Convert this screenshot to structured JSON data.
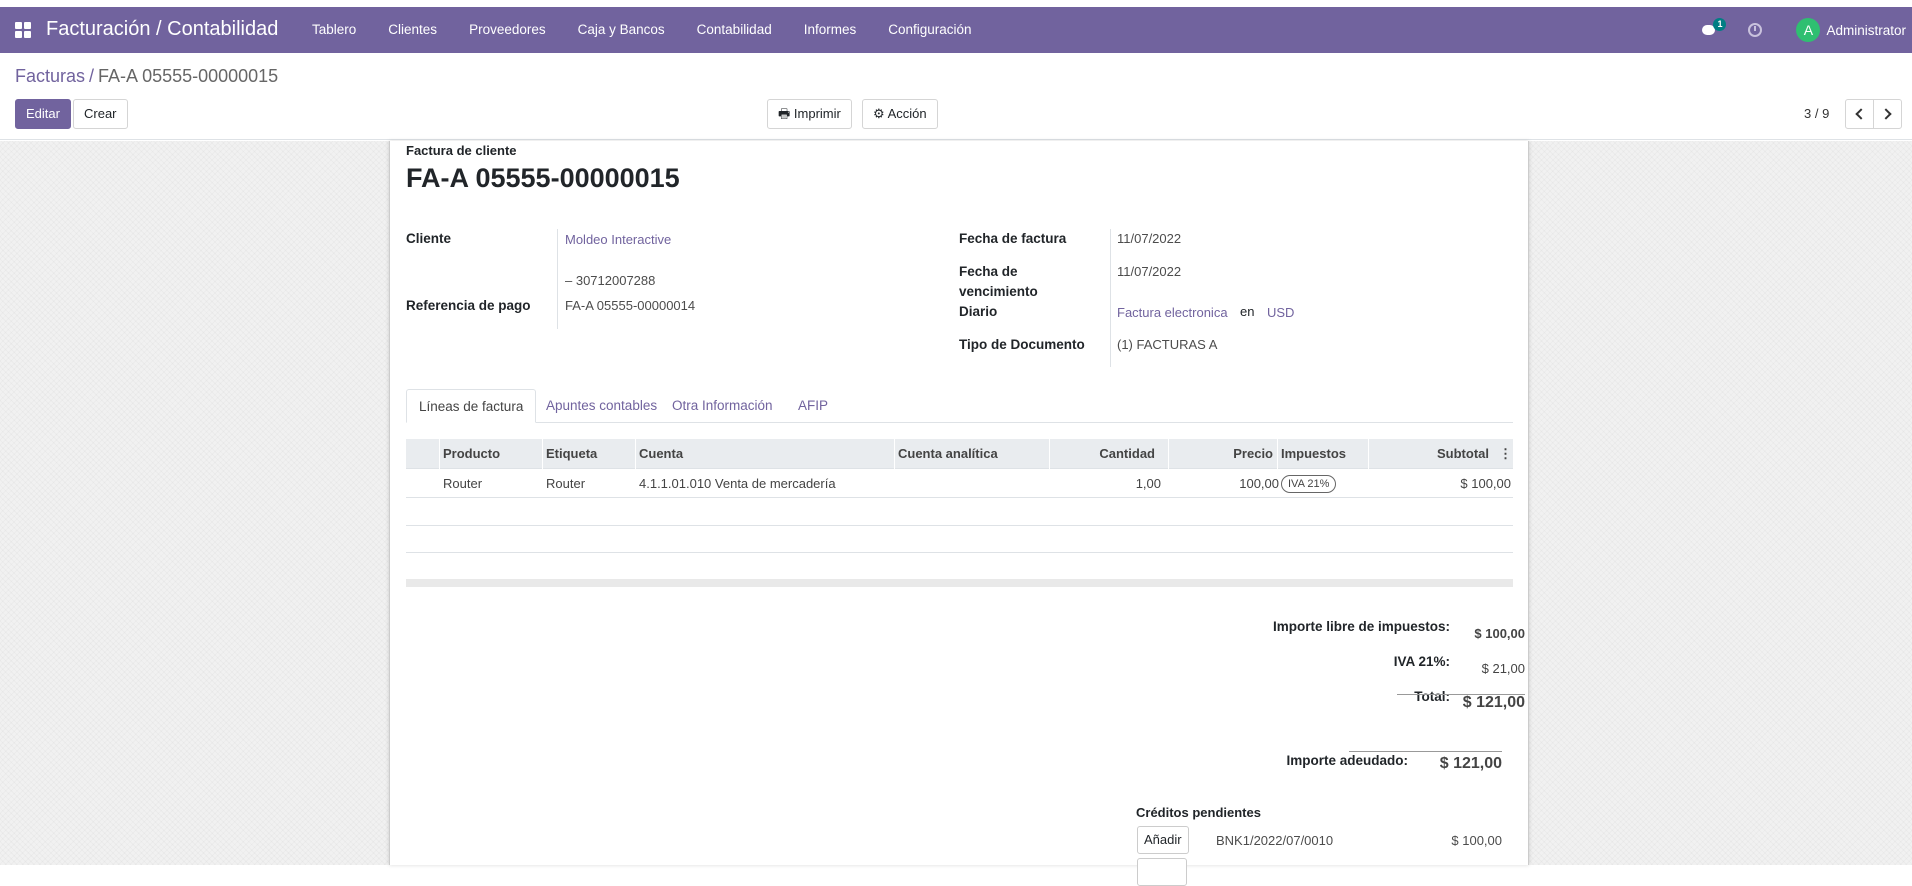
{
  "topbar": {
    "app_title": "Facturación / Contabilidad",
    "menu": [
      "Tablero",
      "Clientes",
      "Proveedores",
      "Caja y Bancos",
      "Contabilidad",
      "Informes",
      "Configuración"
    ],
    "chat_badge": "1",
    "user_initial": "A",
    "user_name": "Administrator",
    "color": "#71639e"
  },
  "control_panel": {
    "breadcrumb_parent": "Facturas",
    "breadcrumb_separator": "/",
    "breadcrumb_current": "FA-A 05555-00000015",
    "edit_label": "Editar",
    "create_label": "Crear",
    "print_label": "Imprimir",
    "action_label": "Acción",
    "pager": "3 / 9"
  },
  "invoice": {
    "type_label": "Factura de cliente",
    "number": "FA-A 05555-00000015",
    "customer_label": "Cliente",
    "customer_name": "Moldeo Interactive",
    "customer_vat": "– 30712007288",
    "payment_ref_label": "Referencia de pago",
    "payment_ref": "FA-A 05555-00000014",
    "invoice_date_label": "Fecha de factura",
    "invoice_date": "11/07/2022",
    "due_date_label_1": "Fecha de",
    "due_date_label_2": "vencimiento",
    "due_date": "11/07/2022",
    "journal_label": "Diario",
    "journal": "Factura electronica",
    "journal_in": "en",
    "currency": "USD",
    "doc_type_label": "Tipo de Documento",
    "doc_type": "(1) FACTURAS A"
  },
  "tabs": [
    "Líneas de factura",
    "Apuntes contables",
    "Otra Información",
    "AFIP"
  ],
  "lines": {
    "headers": [
      "Producto",
      "Etiqueta",
      "Cuenta",
      "Cuenta analítica",
      "Cantidad",
      "Precio",
      "Impuestos",
      "Subtotal"
    ],
    "rows": [
      {
        "product": "Router",
        "label": "Router",
        "account": "4.1.1.01.010 Venta de mercadería",
        "analytic": "",
        "qty": "1,00",
        "price": "100,00",
        "tax": "IVA 21%",
        "subtotal": "$ 100,00"
      }
    ]
  },
  "totals": {
    "untaxed_label": "Importe libre de impuestos:",
    "untaxed": "$ 100,00",
    "tax_label": "IVA 21%:",
    "tax": "$ 21,00",
    "total_label": "Total:",
    "total": "$ 121,00",
    "due_label": "Importe adeudado:",
    "due": "$ 121,00"
  },
  "credits": {
    "title": "Créditos pendientes",
    "add_label": "Añadir",
    "ref": "BNK1/2022/07/0010",
    "amount": "$ 100,00"
  }
}
